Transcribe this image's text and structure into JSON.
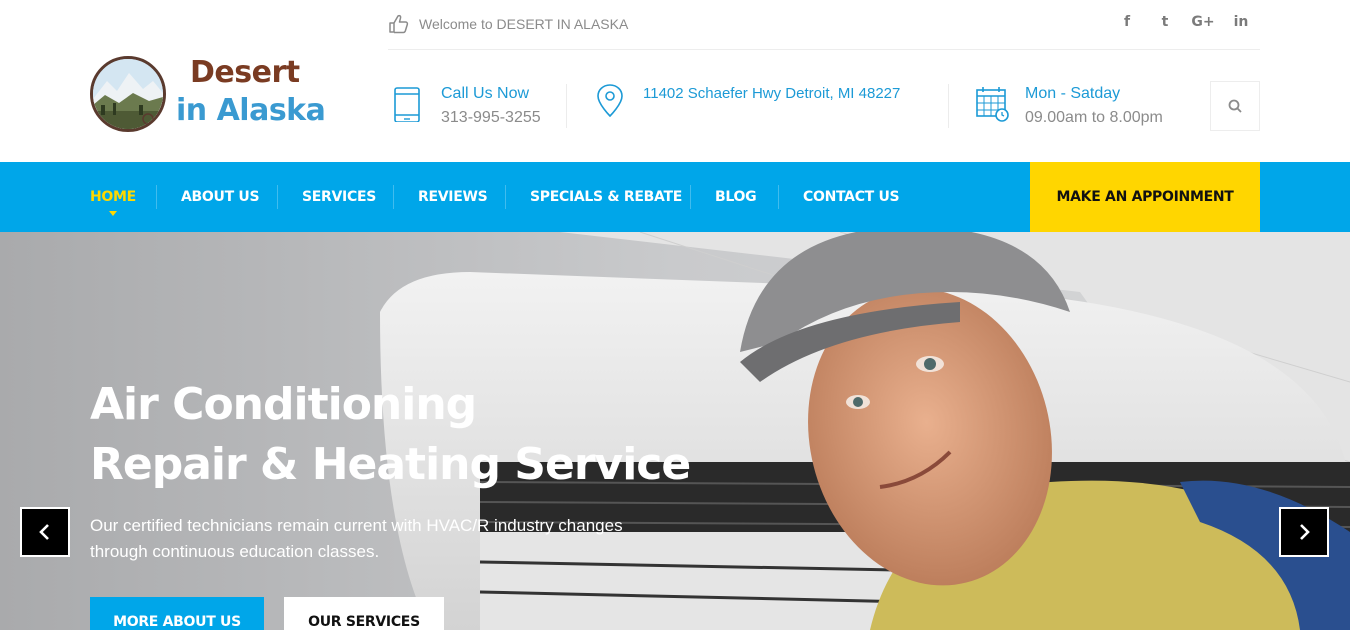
{
  "brand": {
    "line1": "Desert",
    "line2": "in Alaska"
  },
  "topbar": {
    "welcome": "Welcome to DESERT IN ALASKA",
    "socials": [
      "f",
      "t",
      "G+",
      "in"
    ]
  },
  "contact": {
    "phone_label": "Call Us Now",
    "phone_value": "313-995-3255",
    "address": "11402 Schaefer Hwy Detroit, MI 48227",
    "hours_label": "Mon - Satday",
    "hours_value": "09.00am to 8.00pm"
  },
  "nav": {
    "items": [
      {
        "label": "HOME",
        "active": true
      },
      {
        "label": "ABOUT US",
        "active": false
      },
      {
        "label": "SERVICES",
        "active": false
      },
      {
        "label": "REVIEWS",
        "active": false
      },
      {
        "label": "SPECIALS & REBATE",
        "active": false
      },
      {
        "label": "BLOG",
        "active": false
      },
      {
        "label": "CONTACT US",
        "active": false
      }
    ],
    "cta": "MAKE AN APPOINMENT"
  },
  "hero": {
    "title_line1": "Air Conditioning",
    "title_line2": "Repair & Heating Service",
    "subtitle_line1": "Our certified technicians remain current with HVAC/R industry changes",
    "subtitle_line2": "through continuous education classes.",
    "primary_button": "MORE ABOUT US",
    "secondary_button": "OUR SERVICES"
  },
  "colors": {
    "accent_blue": "#00a6e9",
    "accent_yellow": "#ffd600",
    "brand_brown": "#7a3b22",
    "brand_blue": "#3a9ad1"
  },
  "icons": {
    "welcome": "thumbs-up-icon",
    "phone": "mobile-phone-icon",
    "address": "map-pin-icon",
    "hours": "calendar-clock-icon",
    "search": "search-icon",
    "prev": "chevron-left-icon",
    "next": "chevron-right-icon"
  }
}
